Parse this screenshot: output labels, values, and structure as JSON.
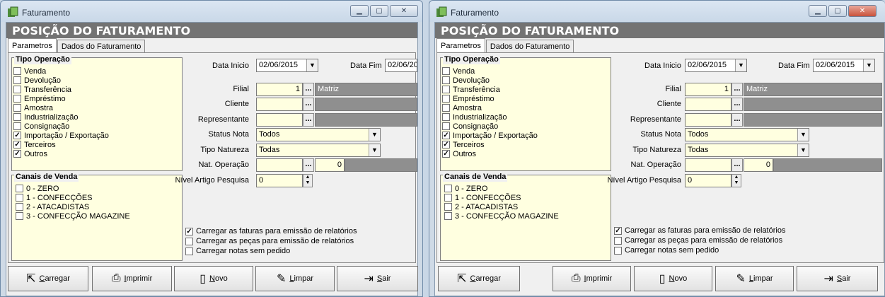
{
  "window_title": "Faturamento",
  "window_buttons": {
    "minimize": "▁",
    "maximize": "▢",
    "close": "✕"
  },
  "header_title": "POSIÇÃO DO FATURAMENTO",
  "tabs": [
    "Parametros",
    "Dados do Faturamento"
  ],
  "tipo_operacao": {
    "title": "Tipo Operação",
    "items": [
      {
        "label": "Venda",
        "checked": false
      },
      {
        "label": "Devolução",
        "checked": false
      },
      {
        "label": "Transferência",
        "checked": false
      },
      {
        "label": "Empréstimo",
        "checked": false
      },
      {
        "label": "Amostra",
        "checked": false
      },
      {
        "label": "Industrialização",
        "checked": false
      },
      {
        "label": "Consignação",
        "checked": false
      },
      {
        "label": "Importação / Exportação",
        "checked": true
      },
      {
        "label": "Terceiros",
        "checked": true
      },
      {
        "label": "Outros",
        "checked": true
      }
    ]
  },
  "canais_venda": {
    "title": "Canais de Venda",
    "items": [
      {
        "label": "0 - ZERO",
        "checked": false
      },
      {
        "label": "1 - CONFECÇÕES",
        "checked": false
      },
      {
        "label": "2 - ATACADISTAS",
        "checked": false
      },
      {
        "label": "3 - CONFECÇÃO MAGAZINE",
        "checked": false
      }
    ]
  },
  "form": {
    "data_inicio_label": "Data Inicio",
    "data_inicio_value": "02/06/2015",
    "data_fim_label": "Data Fim",
    "data_fim_value_w1": "02/06/20",
    "data_fim_value_w2": "02/06/2015",
    "filial_label": "Filial",
    "filial_value": "1",
    "filial_name": "Matriz",
    "cliente_label": "Cliente",
    "representante_label": "Representante",
    "status_nota_label": "Status Nota",
    "status_nota_value": "Todos",
    "tipo_natureza_label": "Tipo Natureza",
    "tipo_natureza_value": "Todas",
    "nat_operacao_label": "Nat. Operação",
    "nat_operacao_value": "0",
    "nivel_label": "Nível Artigo Pesquisa",
    "nivel_value": "0",
    "ellipsis": "...",
    "dropdown_arrow": "▼",
    "spin_up": "▲",
    "spin_down": "▼"
  },
  "options": [
    {
      "label": "Carregar as faturas para emissão de relatórios",
      "checked": true
    },
    {
      "label": "Carregar as peças para emissão de relatórios",
      "checked": false
    },
    {
      "label": "Carregar notas sem pedido",
      "checked": false
    }
  ],
  "buttons": [
    {
      "name": "carregar",
      "first": "C",
      "rest": "arregar",
      "icon": "load-icon",
      "glyph": "⇱"
    },
    {
      "name": "imprimir",
      "first": "I",
      "rest": "mprimir",
      "icon": "printer-icon",
      "glyph": "⎙"
    },
    {
      "name": "novo",
      "first": "N",
      "rest": "ovo",
      "icon": "new-document-icon",
      "glyph": "▯"
    },
    {
      "name": "limpar",
      "first": "L",
      "rest": "impar",
      "icon": "broom-icon",
      "glyph": "✎"
    },
    {
      "name": "sair",
      "first": "S",
      "rest": "air",
      "icon": "exit-icon",
      "glyph": "⇥"
    }
  ],
  "checkmark": "✓",
  "colors": {
    "header_bg": "#737373",
    "field_bg": "#ffffe0",
    "disabled_field": "#8f8f8f"
  }
}
